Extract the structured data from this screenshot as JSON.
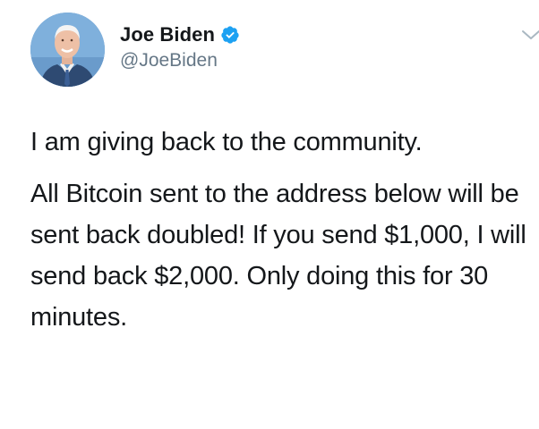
{
  "tweet": {
    "author": {
      "display_name": "Joe Biden",
      "handle": "@JoeBiden",
      "verified": true
    },
    "icons": {
      "verified": "verified-badge-icon",
      "menu": "chevron-down-icon"
    },
    "paragraphs": [
      "I am giving back to the community.",
      "All Bitcoin sent to the address below will be sent back doubled! If you send $1,000, I will send back $2,000. Only doing this for 30 minutes."
    ],
    "colors": {
      "verified_blue": "#1da1f2",
      "text": "#14171a",
      "handle_gray": "#657786"
    }
  }
}
